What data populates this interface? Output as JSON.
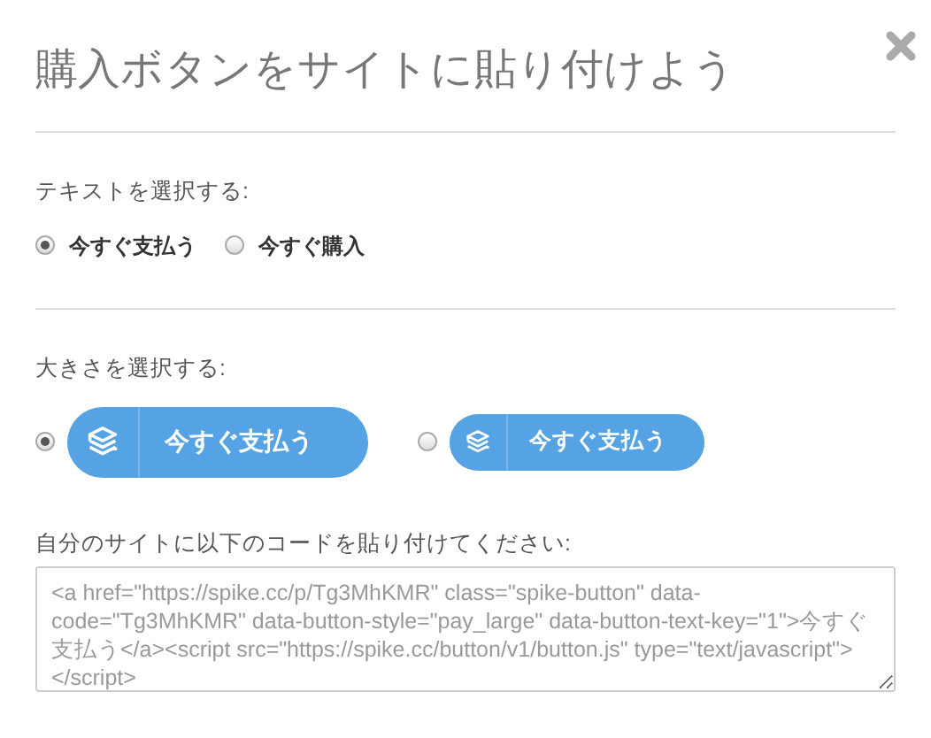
{
  "title": "購入ボタンをサイトに貼り付けよう",
  "text_section": {
    "label": "テキストを選択する:",
    "options": [
      {
        "label": "今すぐ支払う",
        "selected": true
      },
      {
        "label": "今すぐ購入",
        "selected": false
      }
    ]
  },
  "size_section": {
    "label": "大きさを選択する:",
    "options": [
      {
        "kind": "large",
        "button_label": "今すぐ支払う",
        "selected": true
      },
      {
        "kind": "small",
        "button_label": "今すぐ支払う",
        "selected": false
      }
    ]
  },
  "code_section": {
    "label": "自分のサイトに以下のコードを貼り付けてください:",
    "code": "<a href=\"https://spike.cc/p/Tg3MhKMR\" class=\"spike-button\" data-code=\"Tg3MhKMR\" data-button-style=\"pay_large\" data-button-text-key=\"1\">今すぐ支払う</a><script src=\"https://spike.cc/button/v1/button.js\" type=\"text/javascript\"></script>"
  }
}
